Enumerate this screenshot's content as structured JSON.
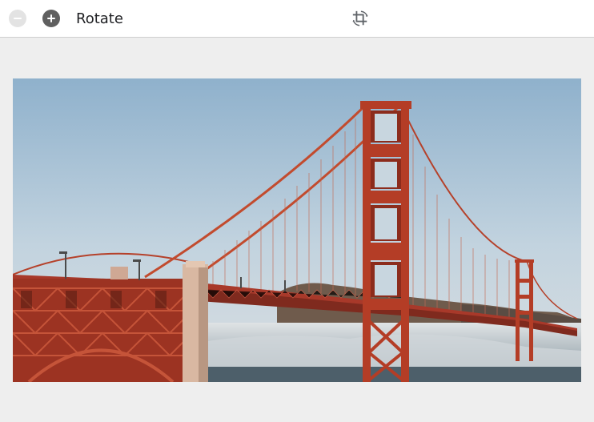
{
  "toolbar": {
    "zoom_out_icon": "minus-circle-icon",
    "zoom_in_icon": "plus-circle-icon",
    "title": "Rotate",
    "rotate_icon": "crop-rotate-icon"
  },
  "image": {
    "subject": "golden-gate-bridge-photo"
  },
  "colors": {
    "toolbar_bg": "#ffffff",
    "page_bg": "#eeeeee",
    "bridge": "#b5412a",
    "sky": "#a9c3d6"
  }
}
